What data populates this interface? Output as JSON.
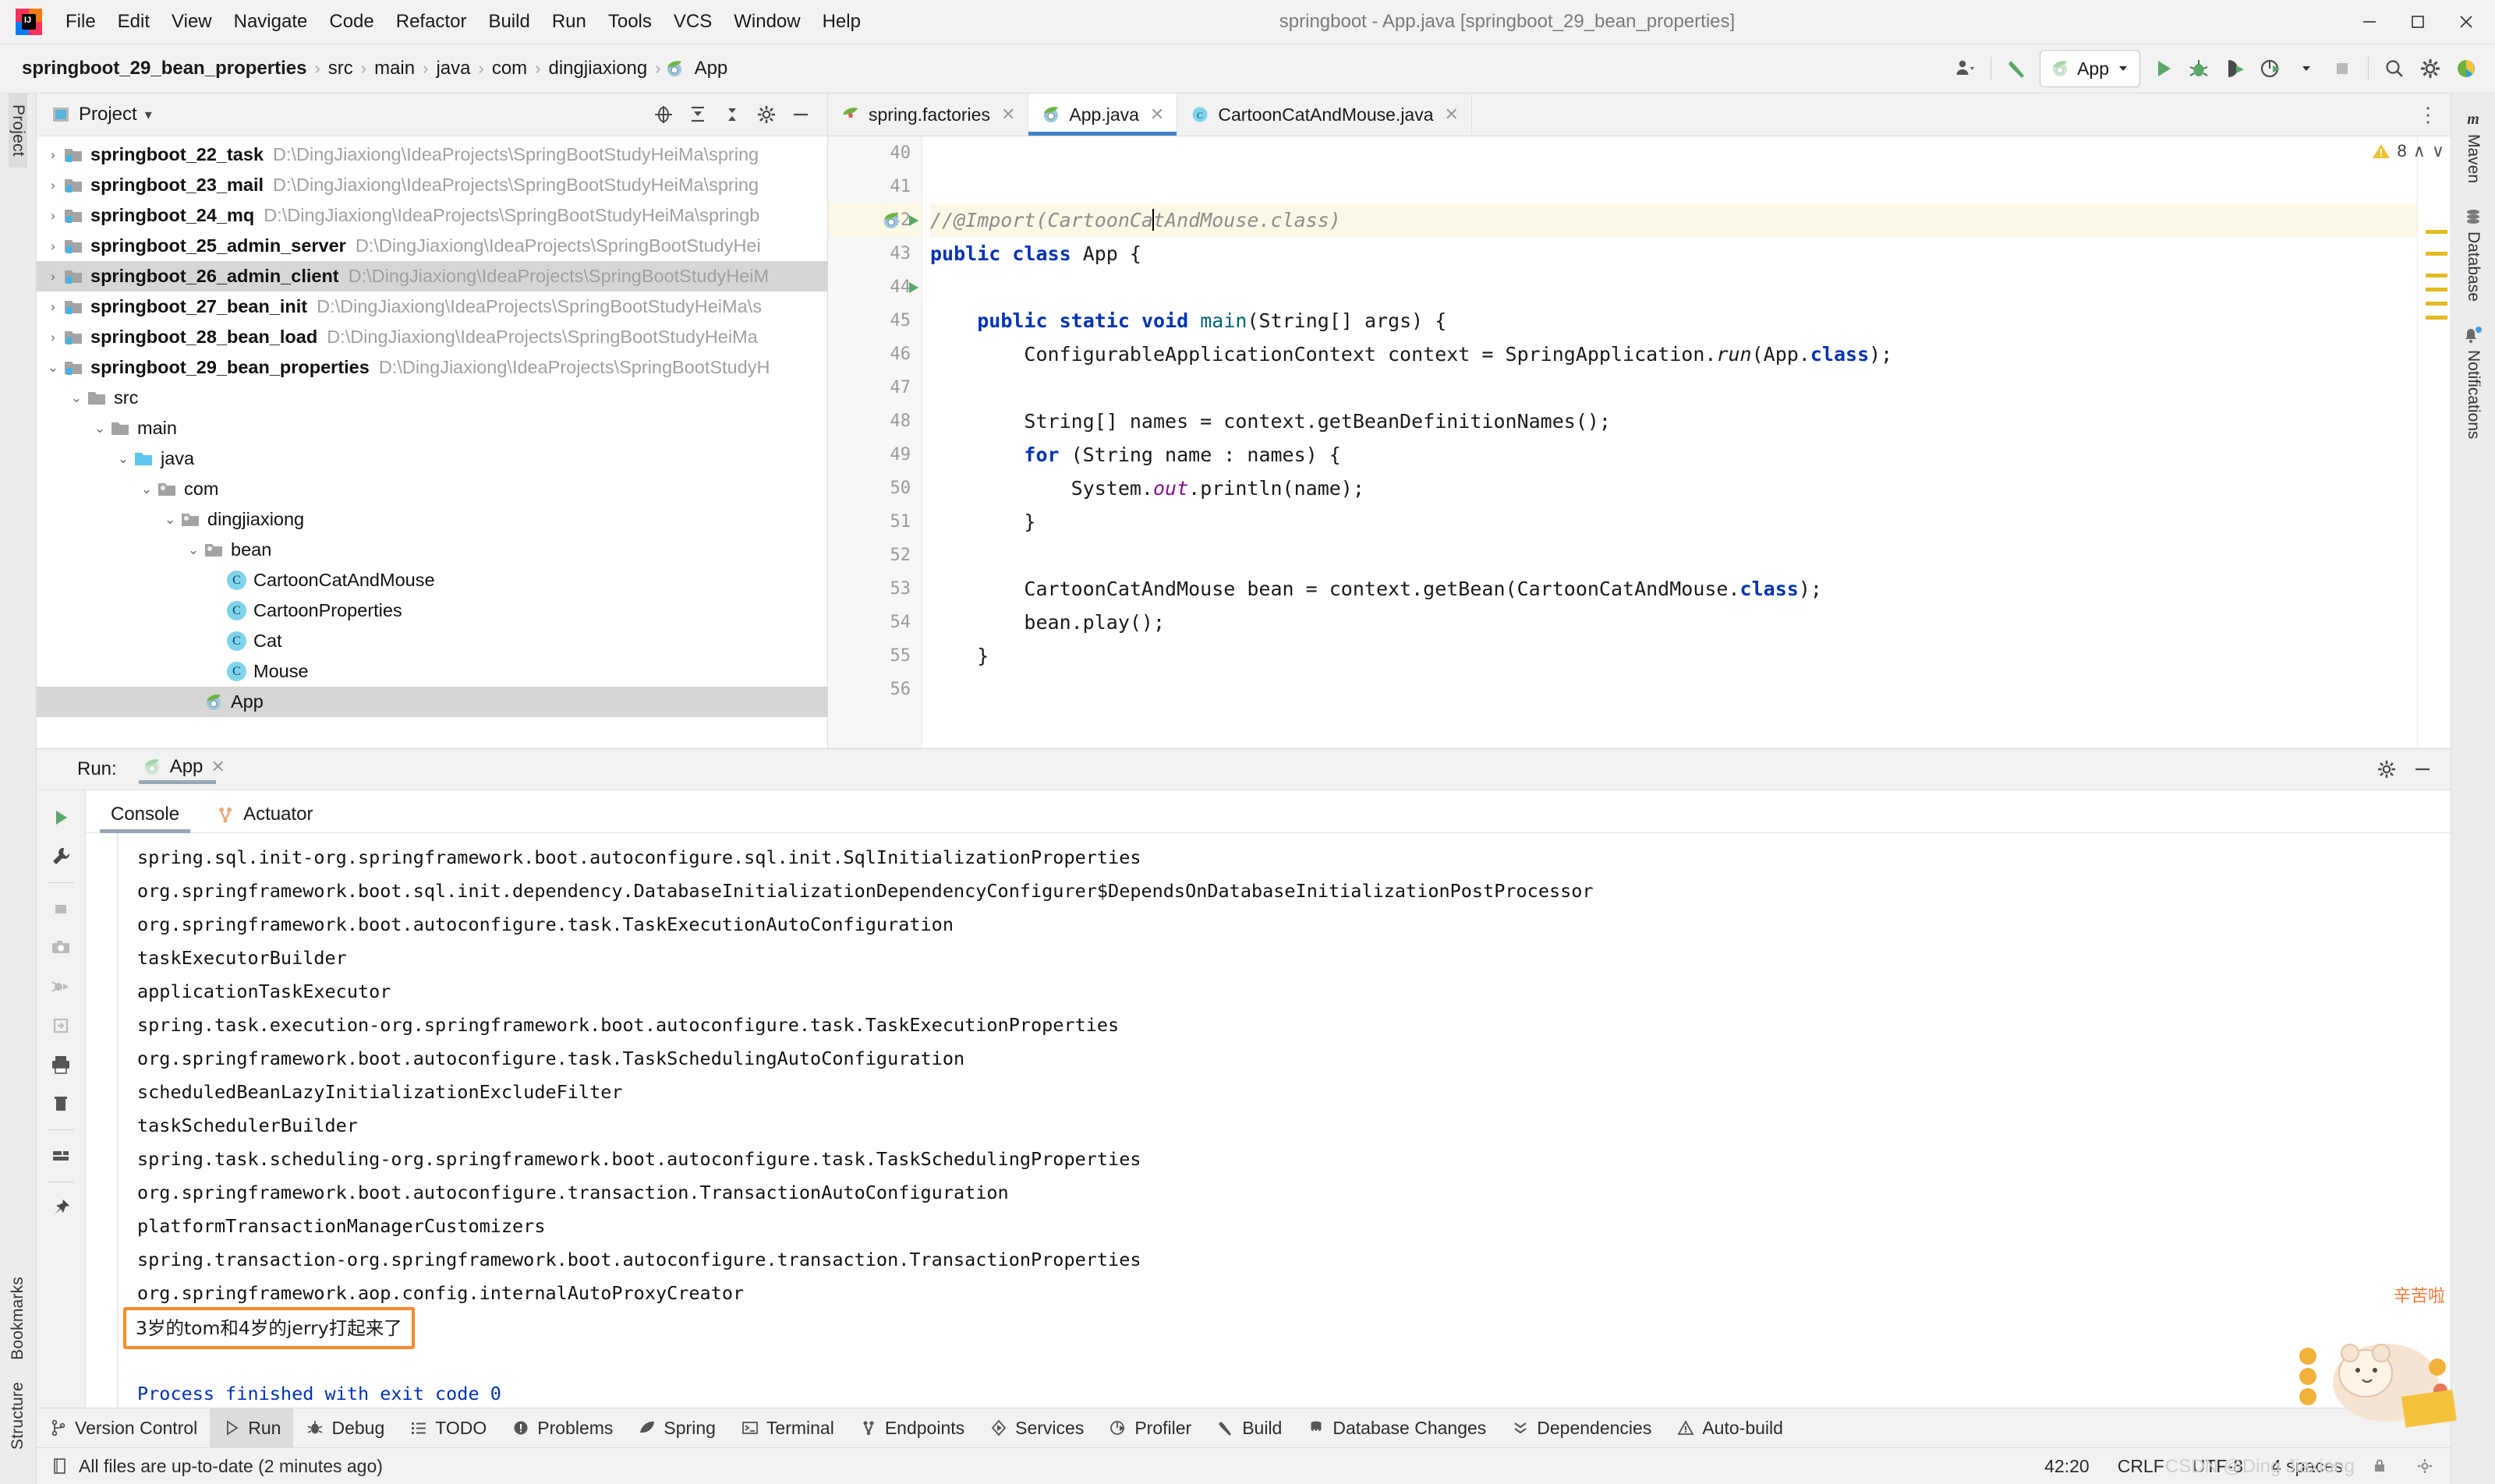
{
  "window": {
    "title": "springboot - App.java [springboot_29_bean_properties]",
    "minimize": "–",
    "maximize": "❐",
    "close": "✕"
  },
  "menu": [
    "File",
    "Edit",
    "View",
    "Navigate",
    "Code",
    "Refactor",
    "Build",
    "Run",
    "Tools",
    "VCS",
    "Window",
    "Help"
  ],
  "breadcrumb": {
    "items": [
      "springboot_29_bean_properties",
      "src",
      "main",
      "java",
      "com",
      "dingjiaxiong",
      "App"
    ],
    "separator": "›"
  },
  "toolbar": {
    "run_config": "App",
    "icons": [
      "user-avatar-icon",
      "build-hammer-icon",
      "run-icon",
      "debug-icon",
      "run-with-coverage-icon",
      "profiler-icon",
      "stop-icon",
      "search-everywhere-icon",
      "settings-gear-icon",
      "ide-help-icon"
    ]
  },
  "left_rail": {
    "tabs": [
      "Project",
      "Bookmarks",
      "Structure"
    ],
    "active": "Project"
  },
  "right_rail": {
    "tabs": [
      "Maven",
      "Database",
      "Notifications"
    ]
  },
  "project_panel": {
    "title": "Project",
    "dropdown": "▾",
    "tree": [
      {
        "indent": 0,
        "arrow": "›",
        "icon": "module-icon",
        "name": "springboot_22_task",
        "path": "D:\\DingJiaxiong\\IdeaProjects\\SpringBootStudyHeiMa\\spring",
        "selected": false
      },
      {
        "indent": 0,
        "arrow": "›",
        "icon": "module-icon",
        "name": "springboot_23_mail",
        "path": "D:\\DingJiaxiong\\IdeaProjects\\SpringBootStudyHeiMa\\spring",
        "selected": false
      },
      {
        "indent": 0,
        "arrow": "›",
        "icon": "module-icon",
        "name": "springboot_24_mq",
        "path": "D:\\DingJiaxiong\\IdeaProjects\\SpringBootStudyHeiMa\\springb",
        "selected": false
      },
      {
        "indent": 0,
        "arrow": "›",
        "icon": "module-icon",
        "name": "springboot_25_admin_server",
        "path": "D:\\DingJiaxiong\\IdeaProjects\\SpringBootStudyHei",
        "selected": false
      },
      {
        "indent": 0,
        "arrow": "›",
        "icon": "module-icon",
        "name": "springboot_26_admin_client",
        "path": "D:\\DingJiaxiong\\IdeaProjects\\SpringBootStudyHeiM",
        "selected": true
      },
      {
        "indent": 0,
        "arrow": "›",
        "icon": "module-icon",
        "name": "springboot_27_bean_init",
        "path": "D:\\DingJiaxiong\\IdeaProjects\\SpringBootStudyHeiMa\\s",
        "selected": false
      },
      {
        "indent": 0,
        "arrow": "›",
        "icon": "module-icon",
        "name": "springboot_28_bean_load",
        "path": "D:\\DingJiaxiong\\IdeaProjects\\SpringBootStudyHeiMa",
        "selected": false
      },
      {
        "indent": 0,
        "arrow": "⌄",
        "icon": "module-icon",
        "name": "springboot_29_bean_properties",
        "path": "D:\\DingJiaxiong\\IdeaProjects\\SpringBootStudyH",
        "selected": false
      },
      {
        "indent": 1,
        "arrow": "⌄",
        "icon": "folder-icon",
        "name": "src",
        "path": "",
        "selected": false,
        "regular": true
      },
      {
        "indent": 2,
        "arrow": "⌄",
        "icon": "folder-icon",
        "name": "main",
        "path": "",
        "selected": false,
        "regular": true
      },
      {
        "indent": 3,
        "arrow": "⌄",
        "icon": "source-folder-icon",
        "name": "java",
        "path": "",
        "selected": false,
        "regular": true
      },
      {
        "indent": 4,
        "arrow": "⌄",
        "icon": "package-icon",
        "name": "com",
        "path": "",
        "selected": false,
        "regular": true
      },
      {
        "indent": 5,
        "arrow": "⌄",
        "icon": "package-icon",
        "name": "dingjiaxiong",
        "path": "",
        "selected": false,
        "regular": true
      },
      {
        "indent": 6,
        "arrow": "⌄",
        "icon": "package-icon",
        "name": "bean",
        "path": "",
        "selected": false,
        "regular": true
      },
      {
        "indent": 7,
        "arrow": "",
        "icon": "class-icon",
        "name": "CartoonCatAndMouse",
        "path": "",
        "selected": false,
        "regular": true
      },
      {
        "indent": 7,
        "arrow": "",
        "icon": "class-icon",
        "name": "CartoonProperties",
        "path": "",
        "selected": false,
        "regular": true
      },
      {
        "indent": 7,
        "arrow": "",
        "icon": "class-icon",
        "name": "Cat",
        "path": "",
        "selected": false,
        "regular": true
      },
      {
        "indent": 7,
        "arrow": "",
        "icon": "class-icon",
        "name": "Mouse",
        "path": "",
        "selected": false,
        "regular": true
      },
      {
        "indent": 6,
        "arrow": "",
        "icon": "spring-class-icon",
        "name": "App",
        "path": "",
        "selected": true,
        "regular": true
      }
    ]
  },
  "editor": {
    "tabs": [
      {
        "label": "spring.factories",
        "icon": "spring-factories-icon",
        "active": false,
        "close": "✕"
      },
      {
        "label": "App.java",
        "icon": "spring-class-icon",
        "active": true,
        "close": "✕"
      },
      {
        "label": "CartoonCatAndMouse.java",
        "icon": "class-icon",
        "active": false,
        "close": "✕"
      }
    ],
    "more": "⋮",
    "inspection_count": "8",
    "inspection_up": "∧",
    "inspection_down": "∨",
    "line_numbers": [
      "40",
      "41",
      "42",
      "43",
      "44",
      "45",
      "46",
      "47",
      "48",
      "49",
      "50",
      "51",
      "52",
      "53",
      "54",
      "55",
      "56"
    ],
    "highlighted_line": "42",
    "lines": [
      {
        "num": "40",
        "text": ""
      },
      {
        "num": "41",
        "text": ""
      },
      {
        "num": "42",
        "text": "//@Import(CartoonCatAndMouse.class)"
      },
      {
        "num": "43",
        "text": "public class App {"
      },
      {
        "num": "44",
        "text": ""
      },
      {
        "num": "45",
        "text": "    public static void main(String[] args) {"
      },
      {
        "num": "46",
        "text": "        ConfigurableApplicationContext context = SpringApplication.run(App.class);"
      },
      {
        "num": "47",
        "text": ""
      },
      {
        "num": "48",
        "text": "        String[] names = context.getBeanDefinitionNames();"
      },
      {
        "num": "49",
        "text": "        for (String name : names) {"
      },
      {
        "num": "50",
        "text": "            System.out.println(name);"
      },
      {
        "num": "51",
        "text": "        }"
      },
      {
        "num": "52",
        "text": ""
      },
      {
        "num": "53",
        "text": "        CartoonCatAndMouse bean = context.getBean(CartoonCatAndMouse.class);"
      },
      {
        "num": "54",
        "text": "        bean.play();"
      },
      {
        "num": "55",
        "text": "    }"
      },
      {
        "num": "56",
        "text": ""
      }
    ]
  },
  "run_panel": {
    "label": "Run:",
    "tab": "App",
    "tab_close": "✕",
    "subtabs": [
      {
        "label": "Console",
        "active": true,
        "icon": ""
      },
      {
        "label": "Actuator",
        "active": false,
        "icon": "actuator-icon"
      }
    ],
    "settings_icon": "gear-icon",
    "minimize_icon": "minimize-icon",
    "rail_icons": [
      "rerun-icon",
      "wrench-icon",
      "stop-icon",
      "camera-icon",
      "debug-suspend-icon",
      "export-icon",
      "print-icon",
      "trash-icon",
      "layout-icon",
      "pin-icon"
    ],
    "console_lines": [
      {
        "text": "spring.sql.init-org.springframework.boot.autoconfigure.sql.init.SqlInitializationProperties",
        "style": "plain"
      },
      {
        "text": "org.springframework.boot.sql.init.dependency.DatabaseInitializationDependencyConfigurer$DependsOnDatabaseInitializationPostProcessor",
        "style": "plain"
      },
      {
        "text": "org.springframework.boot.autoconfigure.task.TaskExecutionAutoConfiguration",
        "style": "plain"
      },
      {
        "text": "taskExecutorBuilder",
        "style": "plain"
      },
      {
        "text": "applicationTaskExecutor",
        "style": "plain"
      },
      {
        "text": "spring.task.execution-org.springframework.boot.autoconfigure.task.TaskExecutionProperties",
        "style": "plain"
      },
      {
        "text": "org.springframework.boot.autoconfigure.task.TaskSchedulingAutoConfiguration",
        "style": "plain"
      },
      {
        "text": "scheduledBeanLazyInitializationExcludeFilter",
        "style": "plain"
      },
      {
        "text": "taskSchedulerBuilder",
        "style": "plain"
      },
      {
        "text": "spring.task.scheduling-org.springframework.boot.autoconfigure.task.TaskSchedulingProperties",
        "style": "plain"
      },
      {
        "text": "org.springframework.boot.autoconfigure.transaction.TransactionAutoConfiguration",
        "style": "plain"
      },
      {
        "text": "platformTransactionManagerCustomizers",
        "style": "plain"
      },
      {
        "text": "spring.transaction-org.springframework.boot.autoconfigure.transaction.TransactionProperties",
        "style": "plain"
      },
      {
        "text": "org.springframework.aop.config.internalAutoProxyCreator",
        "style": "plain"
      }
    ],
    "highlighted_output": "3岁的tom和4岁的jerry打起来了",
    "highlight_border_color": "#ff8a2b",
    "exit_line": "Process finished with exit code 0"
  },
  "tool_windows": [
    {
      "label": "Version Control",
      "icon": "branch-icon",
      "active": false
    },
    {
      "label": "Run",
      "icon": "run-icon",
      "active": true
    },
    {
      "label": "Debug",
      "icon": "debug-icon",
      "active": false
    },
    {
      "label": "TODO",
      "icon": "todo-icon",
      "active": false
    },
    {
      "label": "Problems",
      "icon": "problems-icon",
      "active": false
    },
    {
      "label": "Spring",
      "icon": "spring-leaf-icon",
      "active": false
    },
    {
      "label": "Terminal",
      "icon": "terminal-icon",
      "active": false
    },
    {
      "label": "Endpoints",
      "icon": "endpoints-icon",
      "active": false
    },
    {
      "label": "Services",
      "icon": "services-icon",
      "active": false
    },
    {
      "label": "Profiler",
      "icon": "profiler-icon",
      "active": false
    },
    {
      "label": "Build",
      "icon": "build-hammer-icon",
      "active": false
    },
    {
      "label": "Database Changes",
      "icon": "database-changes-icon",
      "active": false
    },
    {
      "label": "Dependencies",
      "icon": "dependencies-icon",
      "active": false
    },
    {
      "label": "Auto-build",
      "icon": "auto-build-icon",
      "active": false
    }
  ],
  "status_bar": {
    "message": "All files are up-to-date (2 minutes ago)",
    "caret": "42:20",
    "line_sep": "CRLF",
    "encoding": "UTF-8",
    "indent": "4 spaces"
  },
  "watermark": "CSDN @Ding Jiaxiong"
}
